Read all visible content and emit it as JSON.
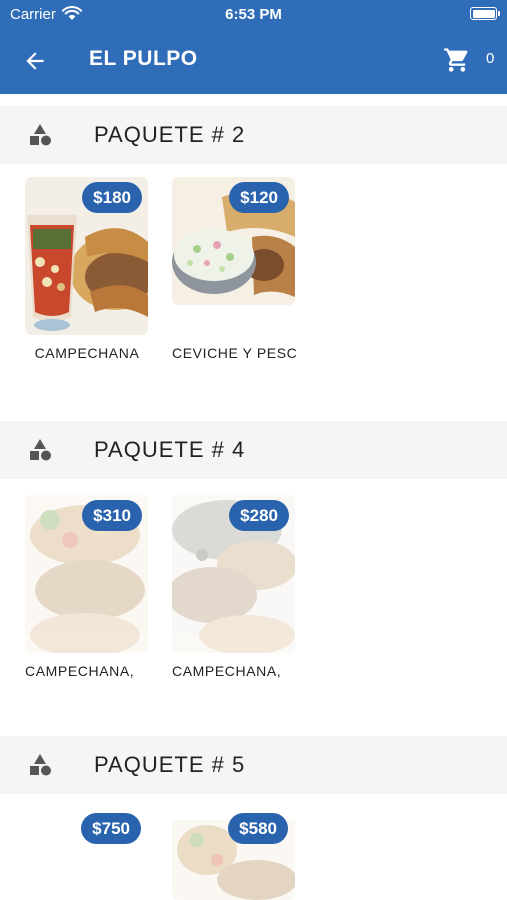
{
  "status_bar": {
    "carrier": "Carrier",
    "time": "6:53 PM",
    "battery_level": 1.0
  },
  "app_bar": {
    "title": "EL PULPO",
    "cart_count": "0",
    "background_color": "#2f6db8"
  },
  "sections": [
    {
      "title": "PAQUETE  # 2",
      "icon": "category-shapes-icon",
      "products": [
        {
          "name": "CAMPECHANA",
          "price": "$180"
        },
        {
          "name": "CEVICHE Y PESCADO",
          "price": "$120"
        }
      ]
    },
    {
      "title": "PAQUETE  # 4",
      "icon": "category-shapes-icon",
      "products": [
        {
          "name": "CAMPECHANA, ",
          "price": "$310"
        },
        {
          "name": "CAMPECHANA, ",
          "price": "$280"
        }
      ]
    },
    {
      "title": "PAQUETE  # 5",
      "icon": "category-shapes-icon",
      "products": [
        {
          "name": "",
          "price": "$750"
        },
        {
          "name": "",
          "price": "$580"
        }
      ]
    }
  ],
  "colors": {
    "accent": "#2f6db8",
    "price_badge": "#2a63ad",
    "section_bg": "#f5f5f5"
  }
}
